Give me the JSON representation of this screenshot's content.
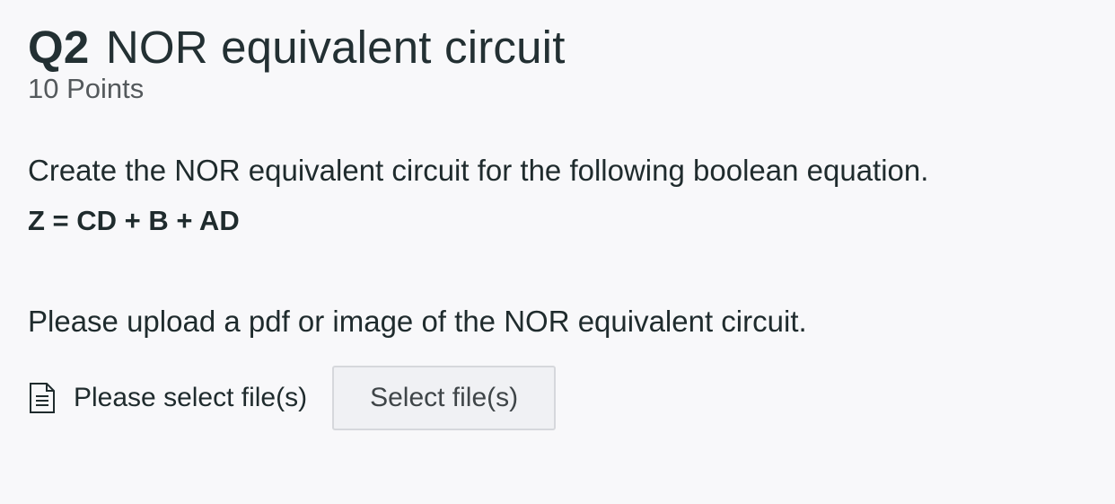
{
  "question": {
    "number": "Q2",
    "title": "NOR equivalent circuit",
    "points": "10 Points",
    "prompt": "Create the NOR equivalent circuit for the following boolean equation.",
    "equation": "Z = CD + B + AD"
  },
  "upload": {
    "instruction": "Please upload a pdf or image of the NOR equivalent circuit.",
    "icon": "file-icon",
    "status": "Please select file(s)",
    "button_label": "Select file(s)"
  },
  "colors": {
    "background": "#f8f8fa",
    "text": "#1f2b2d",
    "muted_text": "#54595c",
    "button_background": "#f0f1f4",
    "button_border": "#d6d8dc"
  }
}
